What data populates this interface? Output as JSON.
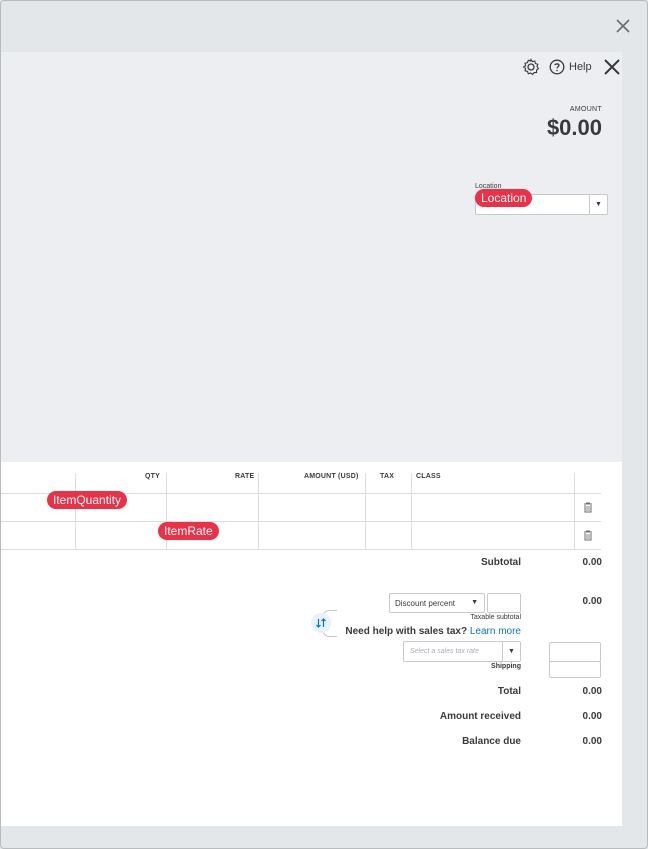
{
  "header": {
    "help_label": "Help",
    "amount_label": "AMOUNT",
    "amount_value": "$0.00",
    "location_label": "Location"
  },
  "annotations": {
    "location": "Location",
    "item_quantity": "ItemQuantity",
    "item_rate": "ItemRate"
  },
  "table": {
    "columns": [
      "QTY",
      "RATE",
      "AMOUNT (USD)",
      "TAX",
      "CLASS"
    ],
    "rows": [
      {
        "qty": "",
        "rate": "",
        "amount": "",
        "tax": "",
        "class": ""
      },
      {
        "qty": "",
        "rate": "",
        "amount": "",
        "tax": "",
        "class": ""
      }
    ]
  },
  "summary": {
    "subtotal_label": "Subtotal",
    "subtotal_value": "0.00",
    "discount_type": "Discount percent",
    "discount_value": "",
    "discount_amount": "0.00",
    "taxable_subtotal_label": "Taxable subtotal",
    "sales_tax_help": "Need help with sales tax?",
    "learn_more": "Learn more",
    "sales_tax_placeholder": "Select a sales tax rate",
    "shipping_label": "Shipping",
    "total_label": "Total",
    "total_value": "0.00",
    "amount_received_label": "Amount received",
    "amount_received_value": "0.00",
    "balance_due_label": "Balance due",
    "balance_due_value": "0.00"
  },
  "colors": {
    "accent_blue": "#0077c5",
    "annotation_red": "#ea3148",
    "header_bg": "#eceef1"
  }
}
